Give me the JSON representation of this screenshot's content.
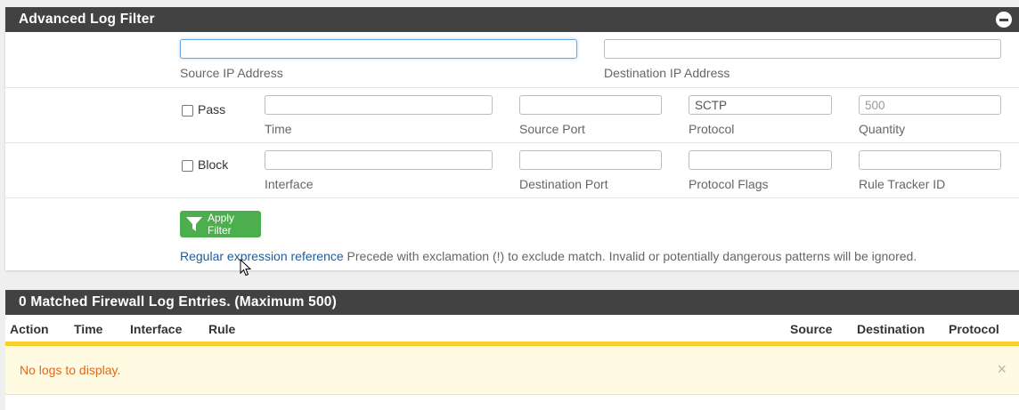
{
  "filter_panel": {
    "title": "Advanced Log Filter",
    "fields": {
      "source_ip": {
        "label": "Source IP Address",
        "value": ""
      },
      "destination_ip": {
        "label": "Destination IP Address",
        "value": ""
      },
      "time": {
        "label": "Time",
        "value": ""
      },
      "source_port": {
        "label": "Source Port",
        "value": ""
      },
      "protocol": {
        "label": "Protocol",
        "value": "SCTP"
      },
      "quantity": {
        "label": "Quantity",
        "placeholder": "500"
      },
      "interface": {
        "label": "Interface",
        "value": ""
      },
      "destination_port": {
        "label": "Destination Port",
        "value": ""
      },
      "protocol_flags": {
        "label": "Protocol Flags",
        "value": ""
      },
      "rule_tracker_id": {
        "label": "Rule Tracker ID",
        "value": ""
      }
    },
    "checkboxes": {
      "pass": "Pass",
      "block": "Block"
    },
    "apply_button": "Apply Filter",
    "help_link": "Regular expression reference",
    "help_text": " Precede with exclamation (!) to exclude match. Invalid or potentially dangerous patterns will be ignored."
  },
  "log_panel": {
    "title": "0 Matched Firewall Log Entries. (Maximum 500)",
    "columns": [
      "Action",
      "Time",
      "Interface",
      "Rule",
      "Source",
      "Destination",
      "Protocol"
    ],
    "empty_message": "No logs to display.",
    "close_glyph": "×"
  },
  "colors": {
    "heading_bg": "#424242",
    "button_green": "#4cae4c",
    "alert_bar": "#f7ce2a",
    "alert_text": "#e0671c",
    "link": "#1f5c99"
  },
  "icons": [
    "minus-circle-icon",
    "filter-icon",
    "close-icon",
    "mouse-cursor-icon"
  ]
}
